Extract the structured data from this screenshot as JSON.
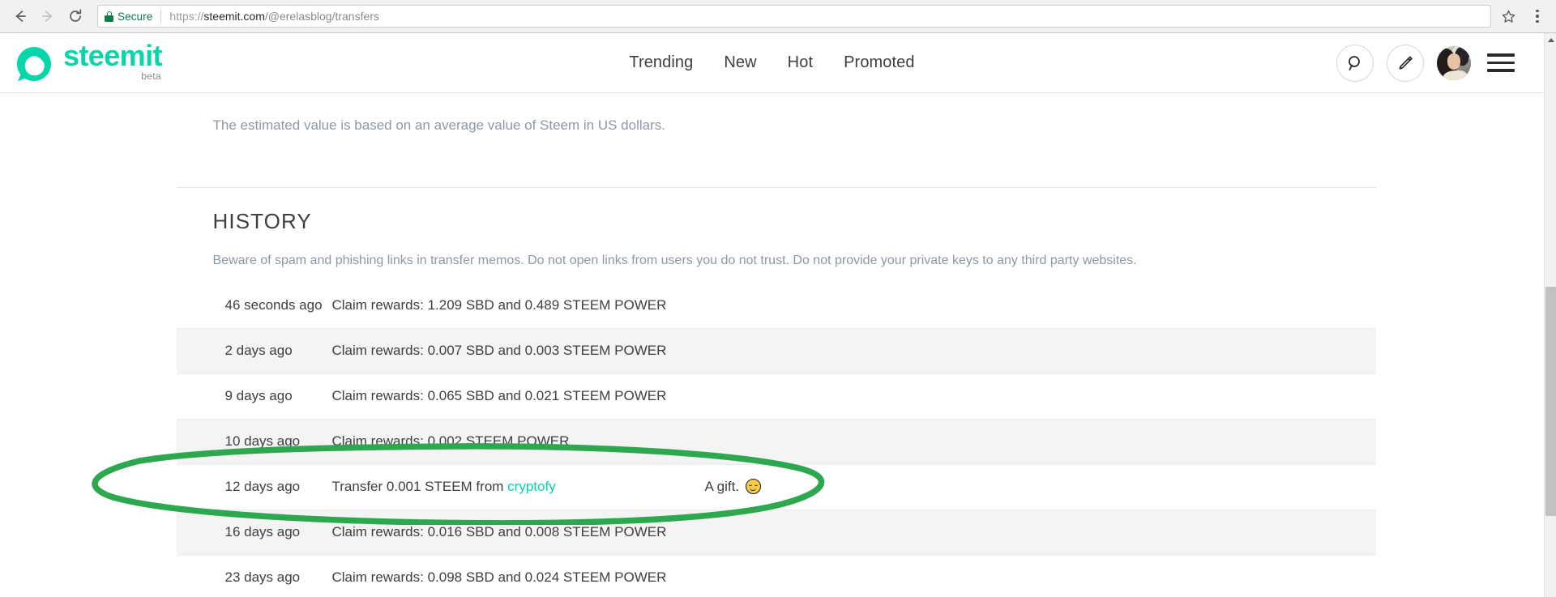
{
  "browser": {
    "back_icon": "arrow-left-icon",
    "forward_icon": "arrow-right-icon",
    "reload_icon": "reload-icon",
    "security_label": "Secure",
    "lock_icon": "lock-icon",
    "url_scheme": "https://",
    "url_host": "steemit.com",
    "url_path": "/@erelasblog/transfers",
    "url_full": "https://steemit.com/@erelasblog/transfers",
    "bookmark_icon": "star-icon",
    "menu_icon": "kebab-menu-icon",
    "secure_color": "#0b8043"
  },
  "site": {
    "brand_name": "steemit",
    "brand_tag": "beta",
    "brand_color": "#06d6a9",
    "logo_icon": "steemit-logo-icon",
    "nav": [
      {
        "label": "Trending"
      },
      {
        "label": "New"
      },
      {
        "label": "Hot"
      },
      {
        "label": "Promoted"
      }
    ],
    "actions": {
      "search_icon": "search-icon",
      "compose_icon": "pencil-icon",
      "avatar_icon": "user-avatar",
      "menu_icon": "hamburger-menu-icon"
    }
  },
  "wallet": {
    "estimate_note": "The estimated value is based on an average value of Steem in US dollars."
  },
  "history": {
    "title": "HISTORY",
    "warning": "Beware of spam and phishing links in transfer memos. Do not open links from users you do not trust. Do not provide your private keys to any third party websites.",
    "rows": [
      {
        "when": "46 seconds ago",
        "what": "Claim rewards: 1.209 SBD and 0.489 STEEM POWER",
        "memo": "",
        "link": "",
        "emoji": ""
      },
      {
        "when": "2 days ago",
        "what": "Claim rewards: 0.007 SBD and 0.003 STEEM POWER",
        "memo": "",
        "link": "",
        "emoji": ""
      },
      {
        "when": "9 days ago",
        "what": "Claim rewards: 0.065 SBD and 0.021 STEEM POWER",
        "memo": "",
        "link": "",
        "emoji": ""
      },
      {
        "when": "10 days ago",
        "what": "Claim rewards: 0.002 STEEM POWER",
        "memo": "",
        "link": "",
        "emoji": ""
      },
      {
        "when": "12 days ago",
        "what": "Transfer 0.001 STEEM from ",
        "memo": "A gift. ",
        "link": "cryptofy",
        "emoji": "smiling-face-emoji"
      },
      {
        "when": "16 days ago",
        "what": "Claim rewards: 0.016 SBD and 0.008 STEEM POWER",
        "memo": "",
        "link": "",
        "emoji": ""
      },
      {
        "when": "23 days ago",
        "what": "Claim rewards: 0.098 SBD and 0.024 STEEM POWER",
        "memo": "",
        "link": "",
        "emoji": ""
      }
    ]
  },
  "annotation": {
    "shape": "hand-drawn-ellipse",
    "color": "#2ea84f",
    "targets_row_index": 4
  },
  "scrollbar": {
    "up_arrow_icon": "scroll-up-arrow-icon",
    "thumb_icon": "scrollbar-thumb"
  }
}
